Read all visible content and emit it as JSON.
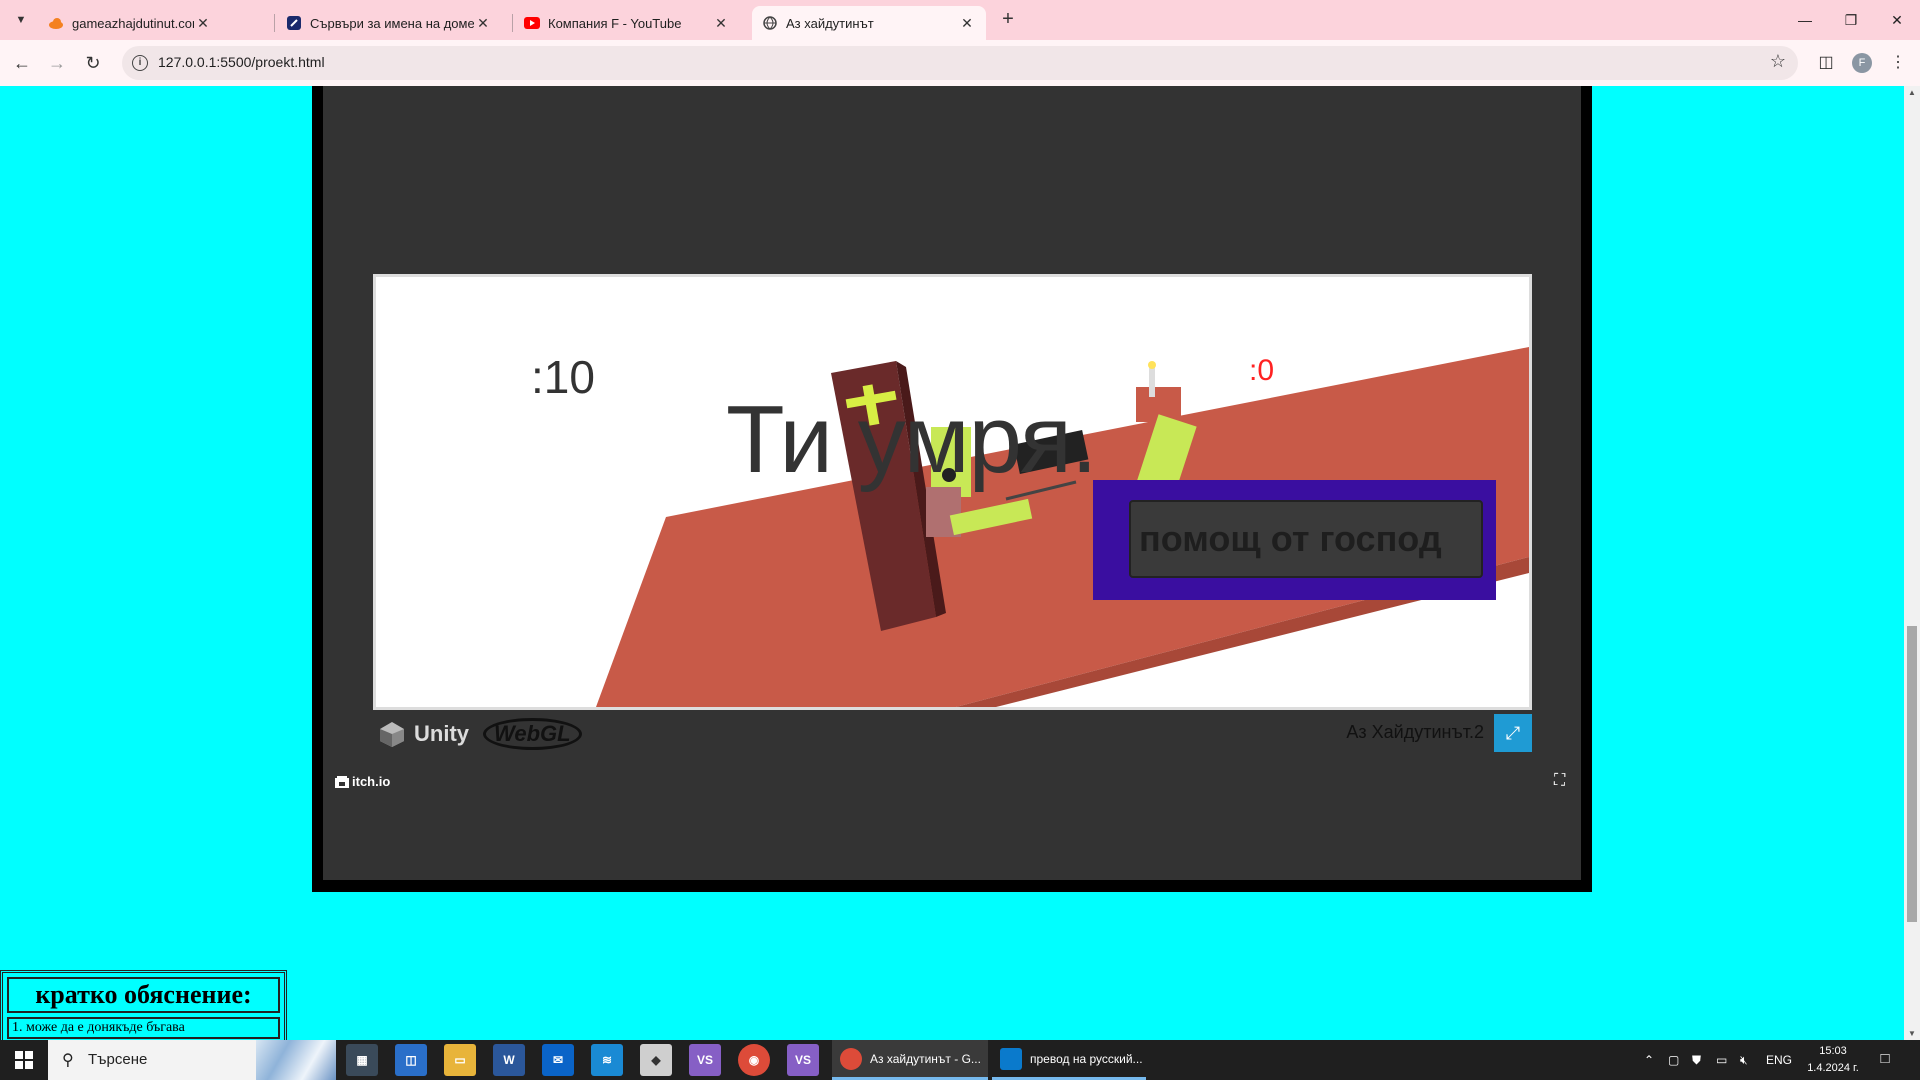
{
  "browser": {
    "tabs": [
      {
        "title": "gameazhajdutinut.com | gamea",
        "active": false
      },
      {
        "title": "Сървъри за имена на домейн",
        "active": false
      },
      {
        "title": "Компания F - YouTube",
        "active": false
      },
      {
        "title": "Аз хайдутинът",
        "active": true
      }
    ],
    "url": "127.0.0.1:5500/proekt.html",
    "profile_initial": "F"
  },
  "game": {
    "score_left": ":10",
    "score_right": ":0",
    "death_message": "Ти умря.",
    "help_button_label": "помощ от господ",
    "title": "Аз Хайдутинът.2",
    "engine_label": "Unity",
    "webgl_label": "WebGL",
    "host_label": "itch.io"
  },
  "explanation": {
    "title": "кратко обяснение:",
    "items": [
      "1. може да е донякъде бъгава"
    ]
  },
  "taskbar": {
    "search_placeholder": "Търсене",
    "windows": [
      {
        "title": "Аз хайдутинът - G...",
        "active": true
      },
      {
        "title": "превод на русский...",
        "active": false
      }
    ],
    "language": "ENG",
    "time": "15:03",
    "date": "1.4.2024 г."
  },
  "colors": {
    "page_bg": "#00ffff",
    "tabbar_bg": "#fcd3dc",
    "score_right": "#ff2222",
    "help_panel": "#3a0ea0",
    "fullscreen_btn": "#1f9bd4"
  }
}
